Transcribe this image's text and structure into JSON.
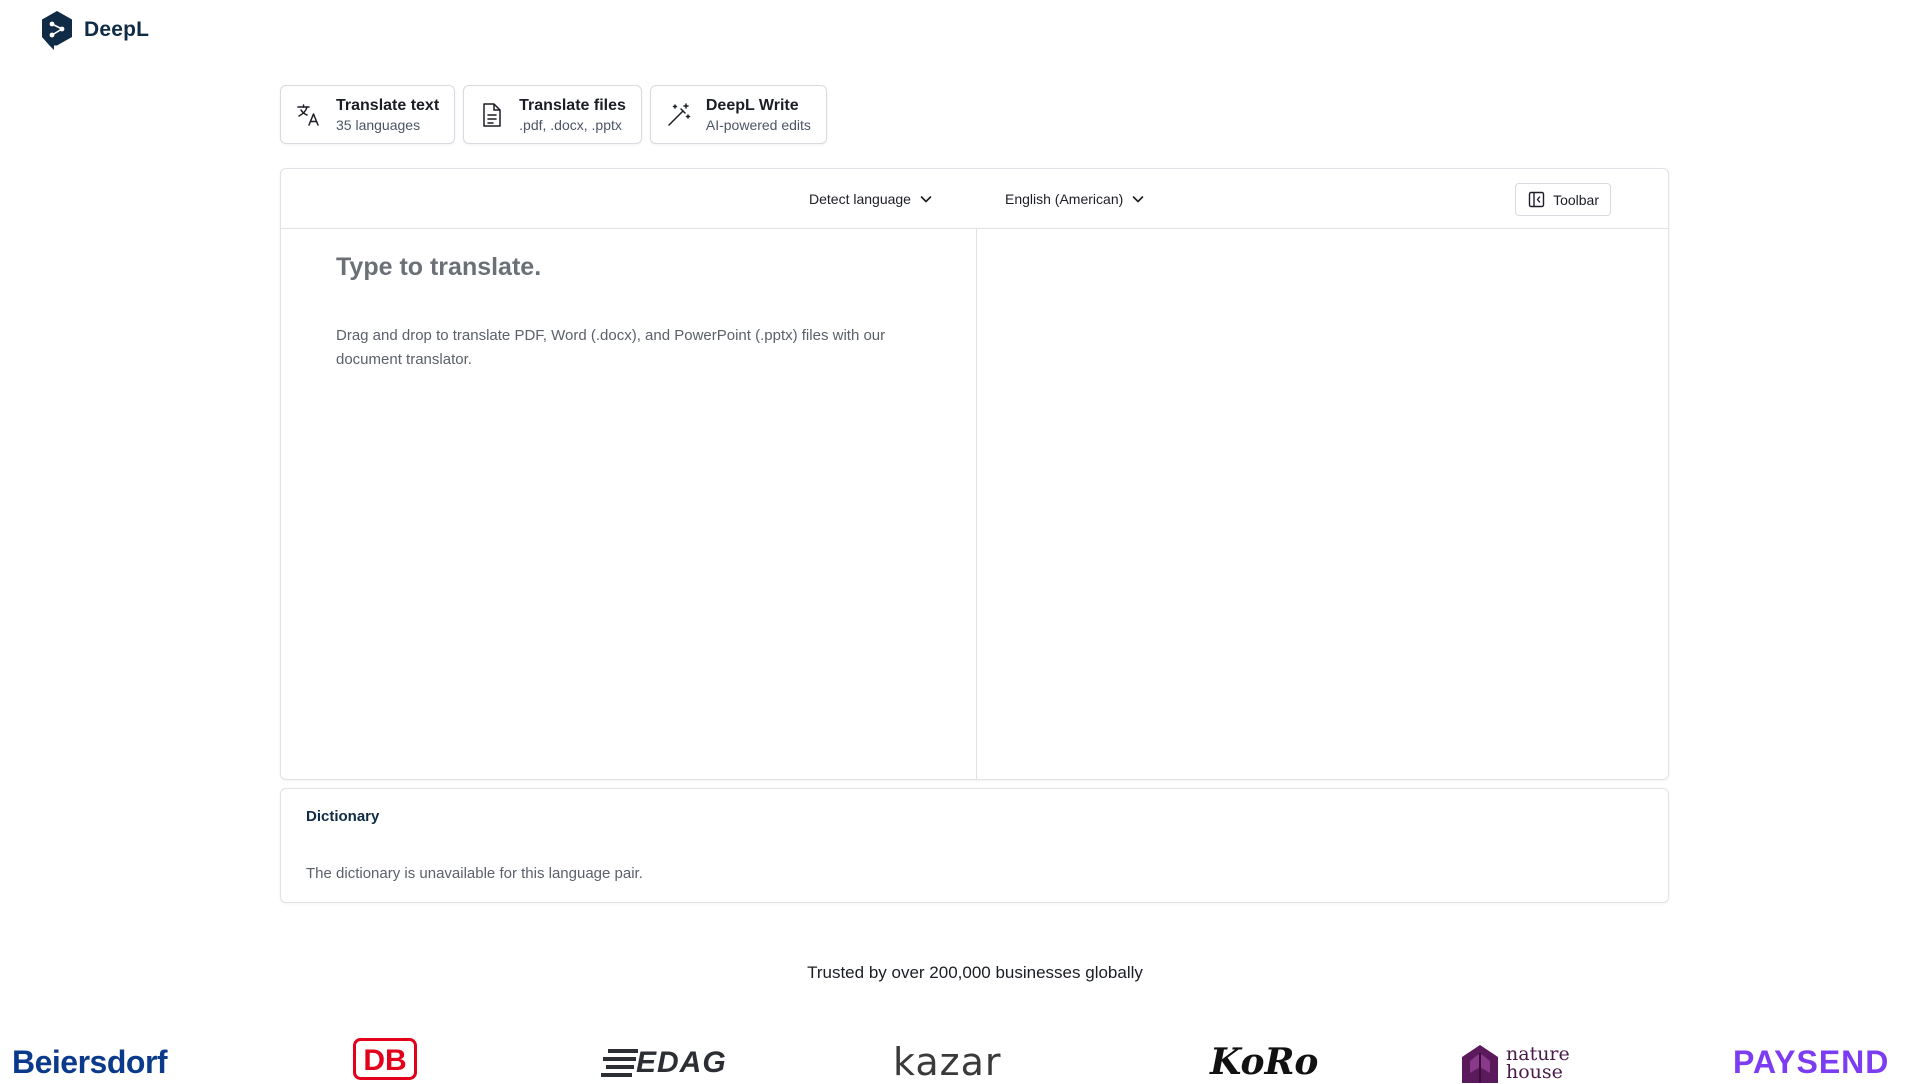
{
  "brand": {
    "name": "DeepL",
    "color": "#0f2b46"
  },
  "tabs": [
    {
      "title": "Translate text",
      "subtitle": "35 languages",
      "icon": "translate-icon"
    },
    {
      "title": "Translate files",
      "subtitle": ".pdf, .docx, .pptx",
      "icon": "file-icon"
    },
    {
      "title": "DeepL Write",
      "subtitle": "AI-powered edits",
      "icon": "magic-wand-icon"
    }
  ],
  "translator": {
    "source_language": "Detect language",
    "target_language": "English (American)",
    "toolbar_label": "Toolbar",
    "source_placeholder": "Type to translate.",
    "source_value": "",
    "source_hint": "Drag and drop to translate PDF, Word (.docx), and PowerPoint (.pptx) files with our document translator."
  },
  "dictionary": {
    "title": "Dictionary",
    "message": "The dictionary is unavailable for this language pair."
  },
  "trusted": {
    "text": "Trusted by over 200,000 businesses globally",
    "logos": [
      "Beiersdorf",
      "DB",
      "EDAG",
      "kazar",
      "KoRo",
      "nature house",
      "PAYSEND"
    ],
    "nature_house_lines": [
      "nature",
      "house"
    ]
  }
}
